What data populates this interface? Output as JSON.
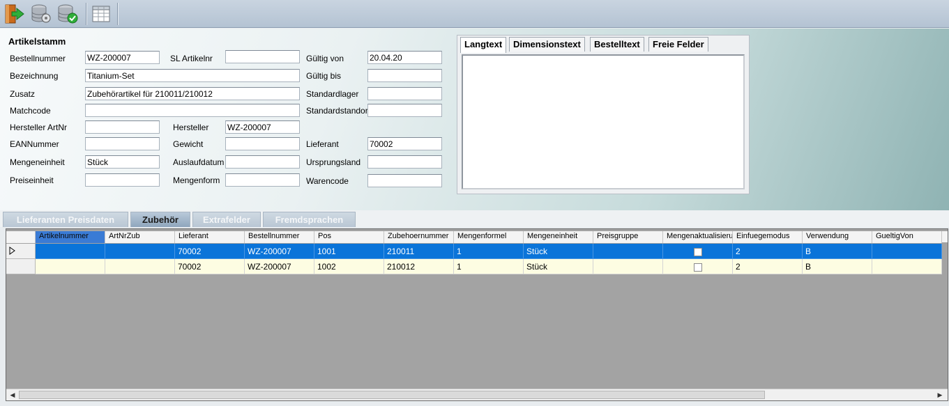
{
  "toolbar": {
    "icons": [
      "exit-door-icon",
      "database-settings-icon",
      "database-check-icon",
      "table-grid-icon"
    ]
  },
  "header": {
    "title": "Artikelstamm",
    "fields": {
      "bestellnummer": {
        "label": "Bestellnummer",
        "value": "WZ-200007"
      },
      "sl_artikelnr": {
        "label": "SL Artikelnr",
        "value": ""
      },
      "gueltig_von": {
        "label": "Gültig von",
        "value": "20.04.20"
      },
      "bezeichnung": {
        "label": "Bezeichnung",
        "value": "Titanium-Set"
      },
      "gueltig_bis": {
        "label": "Gültig bis",
        "value": ""
      },
      "zusatz": {
        "label": "Zusatz",
        "value": "Zubehörartikel für 210011/210012"
      },
      "standardlager": {
        "label": "Standardlager",
        "value": ""
      },
      "matchcode": {
        "label": "Matchcode",
        "value": ""
      },
      "standardstandort": {
        "label": "Standardstandort",
        "value": ""
      },
      "hersteller_artnr": {
        "label": "Hersteller ArtNr",
        "value": ""
      },
      "hersteller": {
        "label": "Hersteller",
        "value": "WZ-200007"
      },
      "eannummer": {
        "label": "EANNummer",
        "value": ""
      },
      "gewicht": {
        "label": "Gewicht",
        "value": ""
      },
      "lieferant": {
        "label": "Lieferant",
        "value": "70002"
      },
      "mengeneinheit": {
        "label": "Mengeneinheit",
        "value": "Stück"
      },
      "auslaufdatum": {
        "label": "Auslaufdatum",
        "value": ""
      },
      "ursprungsland": {
        "label": "Ursprungsland",
        "value": ""
      },
      "preiseinheit": {
        "label": "Preiseinheit",
        "value": ""
      },
      "mengenform": {
        "label": "Mengenform",
        "value": ""
      },
      "warencode": {
        "label": "Warencode",
        "value": ""
      }
    }
  },
  "text_tabs": [
    "Langtext",
    "Dimensionstext",
    "Bestelltext",
    "Freie Felder"
  ],
  "bottom_tabs": [
    "Lieferanten Preisdaten",
    "Zubehör",
    "Extrafelder",
    "Fremdsprachen"
  ],
  "grid": {
    "columns": [
      "Artikelnummer",
      "ArtNrZub",
      "Lieferant",
      "Bestellnummer",
      "Pos",
      "Zubehoernummer",
      "Mengenformel",
      "Mengeneinheit",
      "Preisgruppe",
      "Mengenaktualisieru",
      "Einfuegemodus",
      "Verwendung",
      "GueltigVon"
    ],
    "rows": [
      [
        "",
        "",
        "70002",
        "WZ-200007",
        "1001",
        "210011",
        "1",
        "Stück",
        "",
        "",
        "2",
        "B",
        ""
      ],
      [
        "",
        "",
        "70002",
        "WZ-200007",
        "1002",
        "210012",
        "1",
        "Stück",
        "",
        "",
        "2",
        "B",
        ""
      ]
    ]
  },
  "colors": {
    "selection": "#0a74d9",
    "alt_row": "#fdfde2",
    "grid_bg": "#a3a3a3"
  }
}
